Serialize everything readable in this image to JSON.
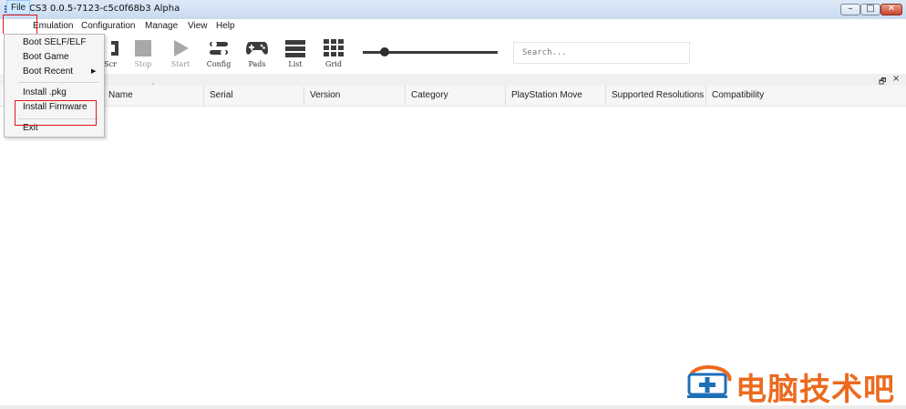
{
  "window": {
    "title": "RPCS3 0.0.5-7123-c5c0f68b3 Alpha",
    "controls": {
      "minimize": "–",
      "maximize": "□",
      "close": "✕"
    }
  },
  "menubar": {
    "items": [
      {
        "label": "File"
      },
      {
        "label": "Emulation"
      },
      {
        "label": "Configuration"
      },
      {
        "label": "Manage"
      },
      {
        "label": "View"
      },
      {
        "label": "Help"
      }
    ]
  },
  "file_menu": {
    "items": [
      {
        "label": "Boot SELF/ELF"
      },
      {
        "label": "Boot Game"
      },
      {
        "label": "Boot Recent",
        "submenu": true
      },
      {
        "label": "Install .pkg"
      },
      {
        "label": "Install Firmware"
      },
      {
        "label": "Exit"
      }
    ]
  },
  "toolbar": {
    "buttons": [
      {
        "label": "Scr",
        "icon": "screen-icon"
      },
      {
        "label": "Stop",
        "icon": "stop-icon",
        "disabled": true
      },
      {
        "label": "Start",
        "icon": "play-icon",
        "disabled": true
      },
      {
        "label": "Config",
        "icon": "config-icon"
      },
      {
        "label": "Pads",
        "icon": "gamepad-icon"
      },
      {
        "label": "List",
        "icon": "list-icon"
      },
      {
        "label": "Grid",
        "icon": "grid-icon"
      }
    ],
    "zoom_slider": {
      "value": 0.16
    },
    "search": {
      "placeholder": "Search..."
    }
  },
  "dock": {
    "float": "🗗",
    "close": "×"
  },
  "game_list": {
    "columns": [
      "Name",
      "Serial",
      "Version",
      "Category",
      "PlayStation Move",
      "Supported Resolutions",
      "Compatibility"
    ],
    "sort_indicator": "˄"
  },
  "watermark": {
    "text": "电脑技术吧"
  },
  "colors": {
    "highlight": "#e0161a",
    "watermark": "#ec6a1e",
    "menu_hover": "#cde8ff"
  }
}
